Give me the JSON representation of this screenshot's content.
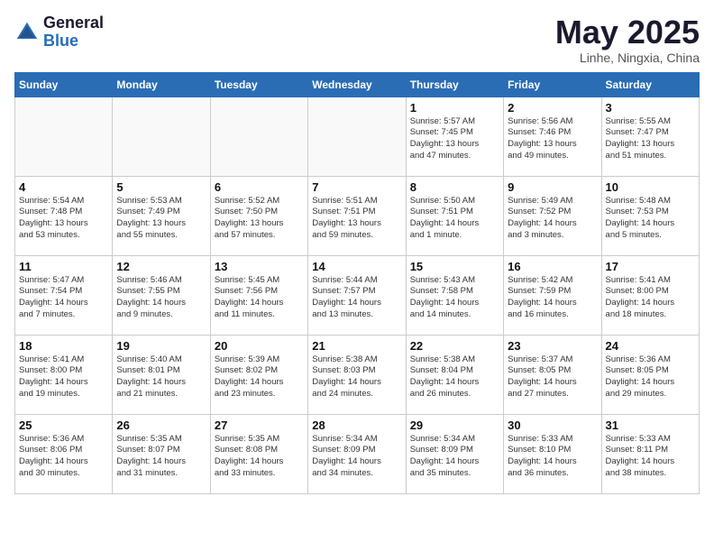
{
  "header": {
    "logo_general": "General",
    "logo_blue": "Blue",
    "month_title": "May 2025",
    "location": "Linhe, Ningxia, China"
  },
  "weekdays": [
    "Sunday",
    "Monday",
    "Tuesday",
    "Wednesday",
    "Thursday",
    "Friday",
    "Saturday"
  ],
  "weeks": [
    [
      {
        "day": "",
        "info": ""
      },
      {
        "day": "",
        "info": ""
      },
      {
        "day": "",
        "info": ""
      },
      {
        "day": "",
        "info": ""
      },
      {
        "day": "1",
        "info": "Sunrise: 5:57 AM\nSunset: 7:45 PM\nDaylight: 13 hours\nand 47 minutes."
      },
      {
        "day": "2",
        "info": "Sunrise: 5:56 AM\nSunset: 7:46 PM\nDaylight: 13 hours\nand 49 minutes."
      },
      {
        "day": "3",
        "info": "Sunrise: 5:55 AM\nSunset: 7:47 PM\nDaylight: 13 hours\nand 51 minutes."
      }
    ],
    [
      {
        "day": "4",
        "info": "Sunrise: 5:54 AM\nSunset: 7:48 PM\nDaylight: 13 hours\nand 53 minutes."
      },
      {
        "day": "5",
        "info": "Sunrise: 5:53 AM\nSunset: 7:49 PM\nDaylight: 13 hours\nand 55 minutes."
      },
      {
        "day": "6",
        "info": "Sunrise: 5:52 AM\nSunset: 7:50 PM\nDaylight: 13 hours\nand 57 minutes."
      },
      {
        "day": "7",
        "info": "Sunrise: 5:51 AM\nSunset: 7:51 PM\nDaylight: 13 hours\nand 59 minutes."
      },
      {
        "day": "8",
        "info": "Sunrise: 5:50 AM\nSunset: 7:51 PM\nDaylight: 14 hours\nand 1 minute."
      },
      {
        "day": "9",
        "info": "Sunrise: 5:49 AM\nSunset: 7:52 PM\nDaylight: 14 hours\nand 3 minutes."
      },
      {
        "day": "10",
        "info": "Sunrise: 5:48 AM\nSunset: 7:53 PM\nDaylight: 14 hours\nand 5 minutes."
      }
    ],
    [
      {
        "day": "11",
        "info": "Sunrise: 5:47 AM\nSunset: 7:54 PM\nDaylight: 14 hours\nand 7 minutes."
      },
      {
        "day": "12",
        "info": "Sunrise: 5:46 AM\nSunset: 7:55 PM\nDaylight: 14 hours\nand 9 minutes."
      },
      {
        "day": "13",
        "info": "Sunrise: 5:45 AM\nSunset: 7:56 PM\nDaylight: 14 hours\nand 11 minutes."
      },
      {
        "day": "14",
        "info": "Sunrise: 5:44 AM\nSunset: 7:57 PM\nDaylight: 14 hours\nand 13 minutes."
      },
      {
        "day": "15",
        "info": "Sunrise: 5:43 AM\nSunset: 7:58 PM\nDaylight: 14 hours\nand 14 minutes."
      },
      {
        "day": "16",
        "info": "Sunrise: 5:42 AM\nSunset: 7:59 PM\nDaylight: 14 hours\nand 16 minutes."
      },
      {
        "day": "17",
        "info": "Sunrise: 5:41 AM\nSunset: 8:00 PM\nDaylight: 14 hours\nand 18 minutes."
      }
    ],
    [
      {
        "day": "18",
        "info": "Sunrise: 5:41 AM\nSunset: 8:00 PM\nDaylight: 14 hours\nand 19 minutes."
      },
      {
        "day": "19",
        "info": "Sunrise: 5:40 AM\nSunset: 8:01 PM\nDaylight: 14 hours\nand 21 minutes."
      },
      {
        "day": "20",
        "info": "Sunrise: 5:39 AM\nSunset: 8:02 PM\nDaylight: 14 hours\nand 23 minutes."
      },
      {
        "day": "21",
        "info": "Sunrise: 5:38 AM\nSunset: 8:03 PM\nDaylight: 14 hours\nand 24 minutes."
      },
      {
        "day": "22",
        "info": "Sunrise: 5:38 AM\nSunset: 8:04 PM\nDaylight: 14 hours\nand 26 minutes."
      },
      {
        "day": "23",
        "info": "Sunrise: 5:37 AM\nSunset: 8:05 PM\nDaylight: 14 hours\nand 27 minutes."
      },
      {
        "day": "24",
        "info": "Sunrise: 5:36 AM\nSunset: 8:05 PM\nDaylight: 14 hours\nand 29 minutes."
      }
    ],
    [
      {
        "day": "25",
        "info": "Sunrise: 5:36 AM\nSunset: 8:06 PM\nDaylight: 14 hours\nand 30 minutes."
      },
      {
        "day": "26",
        "info": "Sunrise: 5:35 AM\nSunset: 8:07 PM\nDaylight: 14 hours\nand 31 minutes."
      },
      {
        "day": "27",
        "info": "Sunrise: 5:35 AM\nSunset: 8:08 PM\nDaylight: 14 hours\nand 33 minutes."
      },
      {
        "day": "28",
        "info": "Sunrise: 5:34 AM\nSunset: 8:09 PM\nDaylight: 14 hours\nand 34 minutes."
      },
      {
        "day": "29",
        "info": "Sunrise: 5:34 AM\nSunset: 8:09 PM\nDaylight: 14 hours\nand 35 minutes."
      },
      {
        "day": "30",
        "info": "Sunrise: 5:33 AM\nSunset: 8:10 PM\nDaylight: 14 hours\nand 36 minutes."
      },
      {
        "day": "31",
        "info": "Sunrise: 5:33 AM\nSunset: 8:11 PM\nDaylight: 14 hours\nand 38 minutes."
      }
    ]
  ]
}
